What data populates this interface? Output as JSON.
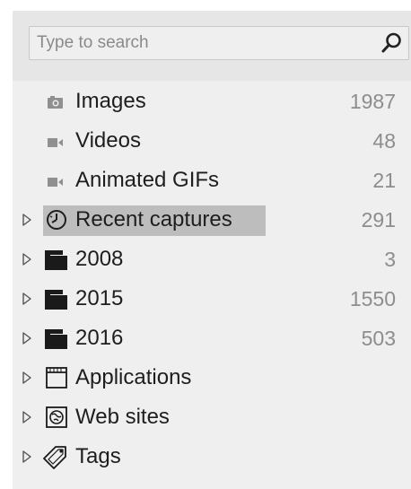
{
  "search": {
    "placeholder": "Type to search",
    "value": ""
  },
  "icons": {
    "search": "search-icon",
    "images": "camera-icon",
    "videos": "video-camera-icon",
    "gifs": "video-camera-icon",
    "recent": "clock-icon",
    "folder": "folder-stack-icon",
    "applications": "window-icon",
    "websites": "globe-icon",
    "tags": "tag-icon",
    "expander": "triangle-right-icon"
  },
  "colors": {
    "selected_bg": "#bdbdbd",
    "count_text": "#8d8d8d",
    "panel_bg": "#efefef"
  },
  "items": [
    {
      "label": "Images",
      "count": "1987"
    },
    {
      "label": "Videos",
      "count": "48"
    },
    {
      "label": "Animated GIFs",
      "count": "21"
    },
    {
      "label": "Recent captures",
      "count": "291",
      "selected": true
    },
    {
      "label": "2008",
      "count": "3"
    },
    {
      "label": "2015",
      "count": "1550"
    },
    {
      "label": "2016",
      "count": "503"
    },
    {
      "label": "Applications",
      "count": ""
    },
    {
      "label": "Web sites",
      "count": ""
    },
    {
      "label": "Tags",
      "count": ""
    }
  ]
}
